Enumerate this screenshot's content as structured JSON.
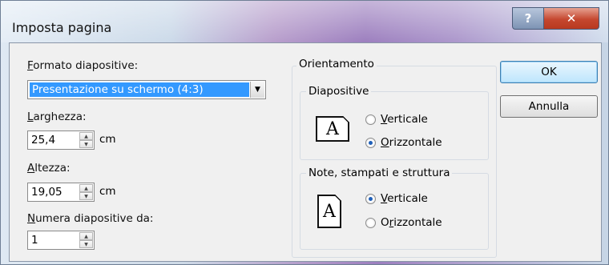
{
  "window": {
    "title": "Imposta pagina",
    "help_glyph": "?",
    "close_glyph": "✕"
  },
  "left": {
    "formato_label_ul": "F",
    "formato_label_rest": "ormato diapositive:",
    "formato_value": "Presentazione su schermo (4:3)",
    "larghezza_label_ul": "L",
    "larghezza_label_rest": "arghezza:",
    "larghezza_value": "25,4",
    "larghezza_unit": "cm",
    "altezza_label_ul": "A",
    "altezza_label_rest": "ltezza:",
    "altezza_value": "19,05",
    "altezza_unit": "cm",
    "numera_label_ul": "N",
    "numera_label_rest": "umera diapositive da:",
    "numera_value": "1"
  },
  "orientation": {
    "group_title": "Orientamento",
    "slides": {
      "title": "Diapositive",
      "icon_letter": "A",
      "options": [
        {
          "ul": "V",
          "rest": "erticale",
          "checked": false
        },
        {
          "ul": "O",
          "rest": "rizzontale",
          "checked": true
        }
      ]
    },
    "notes": {
      "title": "Note, stampati e struttura",
      "icon_letter": "A",
      "options": [
        {
          "ul": "V",
          "prefix": "",
          "rest": "erticale",
          "checked": true
        },
        {
          "ul": "r",
          "prefix": "O",
          "rest": "izzontale",
          "checked": false
        }
      ]
    }
  },
  "buttons": {
    "ok": "OK",
    "cancel": "Annulla"
  }
}
